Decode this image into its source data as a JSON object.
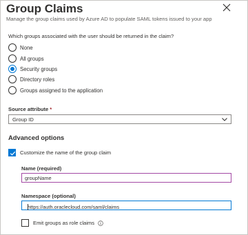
{
  "header": {
    "title": "Group Claims",
    "subtitle": "Manage the group claims used by Azure AD to populate SAML tokens issued to your app",
    "close_icon": "close-icon"
  },
  "groups_question": "Which groups associated with the user should be returned in the claim?",
  "group_options": [
    {
      "label": "None",
      "selected": false
    },
    {
      "label": "All groups",
      "selected": false
    },
    {
      "label": "Security groups",
      "selected": true
    },
    {
      "label": "Directory roles",
      "selected": false
    },
    {
      "label": "Groups assigned to the application",
      "selected": false
    }
  ],
  "source_attribute": {
    "label": "Source attribute",
    "required_marker": "*",
    "value": "Group ID"
  },
  "advanced": {
    "heading": "Advanced options",
    "customize_label": "Customize the name of the group claim",
    "customize_checked": true,
    "name_label": "Name (required)",
    "name_value": "groupName",
    "namespace_label": "Namespace (optional)",
    "namespace_value": "https://auth.oraclecloud.com/saml/claims",
    "emit_label": "Emit groups as role claims",
    "emit_checked": false
  },
  "colors": {
    "accent": "#0078d4",
    "name_field_border": "#a349a4",
    "required_star": "#a4262c"
  }
}
